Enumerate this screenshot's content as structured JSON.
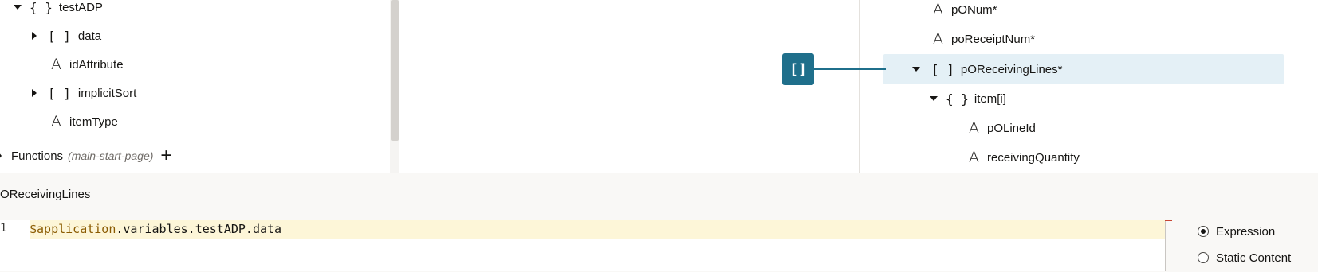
{
  "left_tree": {
    "items": [
      {
        "label": "testADP",
        "glyph": "{ }",
        "expander": "expanded"
      },
      {
        "label": "data",
        "glyph": "[ ]",
        "expander": "collapsed"
      },
      {
        "label": "idAttribute",
        "glyph": "A",
        "expander": "none"
      },
      {
        "label": "implicitSort",
        "glyph": "[ ]",
        "expander": "collapsed"
      },
      {
        "label": "itemType",
        "glyph": "A",
        "expander": "none"
      }
    ],
    "functions": {
      "label": "Functions",
      "context": "(main-start-page)",
      "add_icon": "+"
    }
  },
  "right_tree": {
    "items": [
      {
        "label": "pONum*",
        "glyph": "A"
      },
      {
        "label": "poReceiptNum*",
        "glyph": "A"
      },
      {
        "label": "pOReceivingLines*",
        "glyph": "[ ]",
        "expander": "expanded",
        "selected": true
      },
      {
        "label": "item[i]",
        "glyph": "{ }",
        "expander": "expanded"
      },
      {
        "label": "pOLineId",
        "glyph": "A"
      },
      {
        "label": "receivingQuantity",
        "glyph": "A"
      }
    ],
    "badge_glyph": "[]"
  },
  "bottom": {
    "field_title": "OReceivingLines",
    "line_number": "1",
    "code_var": "$application",
    "code_rest": ".variables.testADP.data",
    "options": [
      {
        "label": "Expression",
        "selected": true
      },
      {
        "label": "Static Content",
        "selected": false
      }
    ]
  },
  "colors": {
    "accent": "#1f6f8b",
    "selection": "#e4f0f6",
    "highlight_line": "#fdf6d8"
  }
}
